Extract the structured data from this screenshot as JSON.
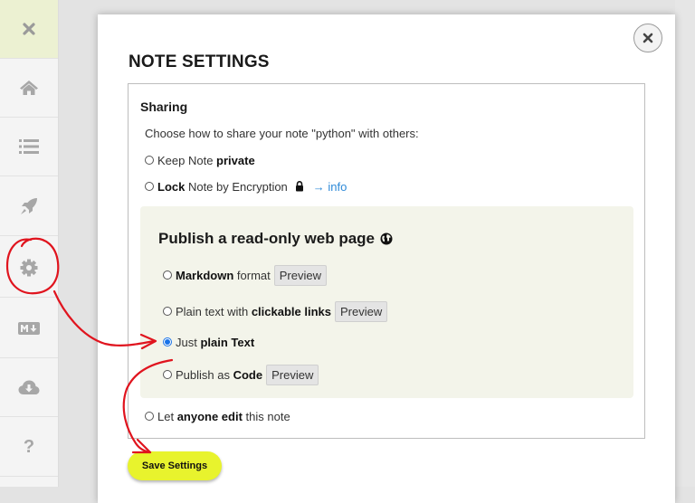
{
  "dialog": {
    "title": "NOTE SETTINGS",
    "sharing": {
      "title": "Sharing",
      "intro": "Choose how to share your note \"python\" with others:",
      "private_option": {
        "prefix": "Keep Note ",
        "bold": "private"
      },
      "lock_option": {
        "bold": "Lock",
        "suffix": " Note by Encryption",
        "info_link": "→ info"
      },
      "publish": {
        "title": "Publish a read-only web page",
        "options": [
          {
            "bold": "Markdown",
            "suffix": " format",
            "preview": "Preview"
          },
          {
            "prefix": "Plain text with ",
            "bold": "clickable links",
            "preview": "Preview"
          },
          {
            "prefix": "Just ",
            "bold": "plain Text",
            "checked": true
          },
          {
            "prefix": "Publish as ",
            "bold": "Code",
            "preview": "Preview"
          }
        ]
      },
      "edit_option": {
        "prefix": "Let ",
        "bold": "anyone edit",
        "suffix": " this note"
      }
    },
    "save_label": "Save Settings"
  },
  "sidebar": {
    "items": [
      {
        "icon": "close-icon"
      },
      {
        "icon": "home-icon"
      },
      {
        "icon": "list-icon"
      },
      {
        "icon": "rocket-icon"
      },
      {
        "icon": "gear-icon"
      },
      {
        "icon": "markdown-icon"
      },
      {
        "icon": "cloud-download-icon"
      },
      {
        "icon": "help-icon",
        "label": "?"
      }
    ]
  },
  "colors": {
    "accent_save": "#e8f32d",
    "link": "#2e8ad8",
    "annotation": "#e0141e",
    "publish_panel": "#f3f4ea"
  }
}
